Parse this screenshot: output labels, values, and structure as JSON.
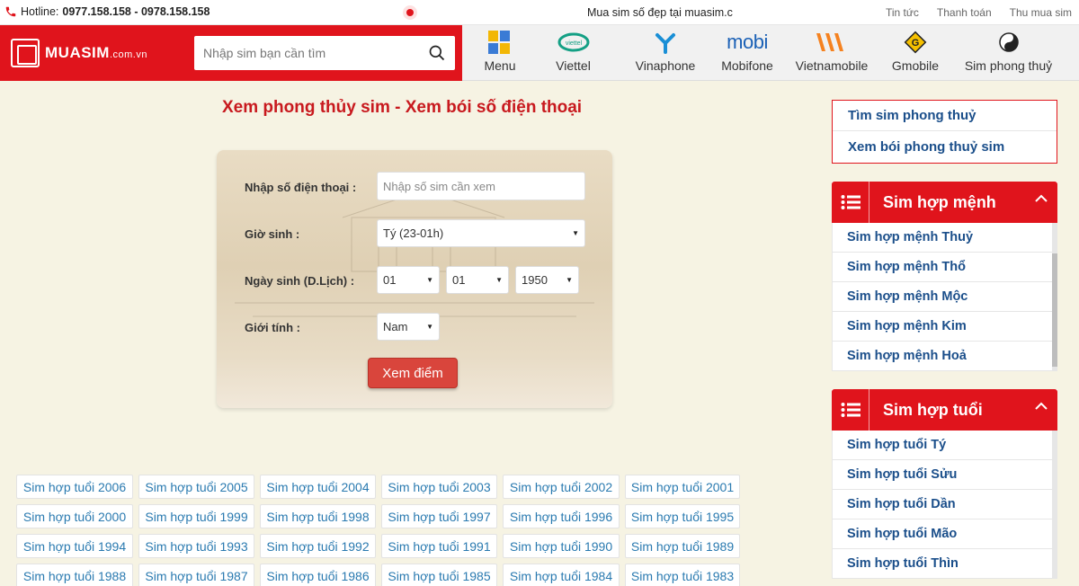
{
  "topbar": {
    "hotline_label": "Hotline:",
    "hotline_numbers": "0977.158.158 - 0978.158.158",
    "marquee": "Mua sim số đẹp tại muasim.c",
    "links": [
      "Tin tức",
      "Thanh toán",
      "Thu mua sim"
    ]
  },
  "header": {
    "logo_text": "MUASIM",
    "logo_suffix": ".com.vn",
    "search_placeholder": "Nhập sim bạn cần tìm",
    "nav": [
      {
        "label": "Menu",
        "icon": "sim-menu-icon"
      },
      {
        "label": "Viettel",
        "icon": "viettel-logo-icon"
      },
      {
        "label": "Vinaphone",
        "icon": "vinaphone-logo-icon"
      },
      {
        "label": "Mobifone",
        "icon": "mobifone-logo-icon"
      },
      {
        "label": "Vietnamobile",
        "icon": "vietnamobile-logo-icon"
      },
      {
        "label": "Gmobile",
        "icon": "gmobile-logo-icon"
      },
      {
        "label": "Sim phong thuỷ",
        "icon": "yin-yang-icon"
      }
    ]
  },
  "main": {
    "title": "Xem phong thủy sim - Xem bói số điện thoại",
    "form": {
      "phone_label": "Nhập số điện thoại :",
      "phone_placeholder": "Nhập số sim cần xem",
      "hour_label": "Giờ sinh :",
      "hour_value": "Tý (23-01h)",
      "date_label": "Ngày sinh (D.Lịch) :",
      "day_value": "01",
      "month_value": "01",
      "year_value": "1950",
      "gender_label": "Giới tính :",
      "gender_value": "Nam",
      "submit_label": "Xem điểm"
    },
    "tags": [
      "Sim hợp tuổi 2006",
      "Sim hợp tuổi 2005",
      "Sim hợp tuổi 2004",
      "Sim hợp tuổi 2003",
      "Sim hợp tuổi 2002",
      "Sim hợp tuổi 2001",
      "Sim hợp tuổi 2000",
      "Sim hợp tuổi 1999",
      "Sim hợp tuổi 1998",
      "Sim hợp tuổi 1997",
      "Sim hợp tuổi 1996",
      "Sim hợp tuổi 1995",
      "Sim hợp tuổi 1994",
      "Sim hợp tuổi 1993",
      "Sim hợp tuổi 1992",
      "Sim hợp tuổi 1991",
      "Sim hợp tuổi 1990",
      "Sim hợp tuổi 1989",
      "Sim hợp tuổi 1988",
      "Sim hợp tuổi 1987",
      "Sim hợp tuổi 1986",
      "Sim hợp tuổi 1985",
      "Sim hợp tuổi 1984",
      "Sim hợp tuổi 1983"
    ]
  },
  "sidebar": {
    "links": [
      "Tìm sim phong thuỷ",
      "Xem bói phong thuỷ sim"
    ],
    "menh_title": "Sim hợp mệnh",
    "menh_items": [
      "Sim hợp mệnh Thuỷ",
      "Sim hợp mệnh Thổ",
      "Sim hợp mệnh Mộc",
      "Sim hợp mệnh Kim",
      "Sim hợp mệnh Hoả"
    ],
    "tuoi_title": "Sim hợp tuổi",
    "tuoi_items": [
      "Sim hợp tuổi Tý",
      "Sim hợp tuổi Sửu",
      "Sim hợp tuổi Dần",
      "Sim hợp tuổi Mão",
      "Sim hợp tuổi Thìn"
    ]
  },
  "colors": {
    "brand_red": "#e0141c",
    "link_blue": "#1a4e8a",
    "tag_blue": "#2a7ab0",
    "title_red": "#c8191e"
  }
}
